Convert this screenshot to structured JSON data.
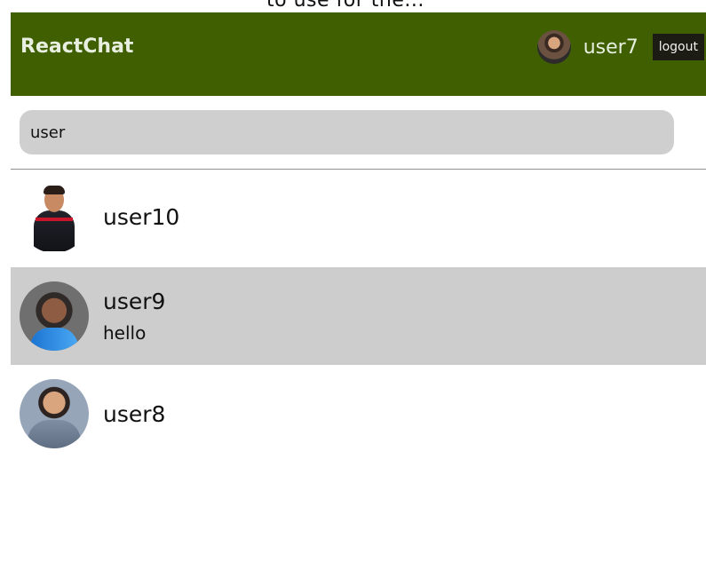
{
  "top_crop": {
    "text": "to use for the..."
  },
  "app": {
    "brand": "ReactChat",
    "current_user": "user7",
    "logout_label": "logout"
  },
  "search": {
    "value": "user",
    "placeholder": ""
  },
  "chats": [
    {
      "name": "user10",
      "message": ""
    },
    {
      "name": "user9",
      "message": "hello"
    },
    {
      "name": "user8",
      "message": ""
    }
  ]
}
